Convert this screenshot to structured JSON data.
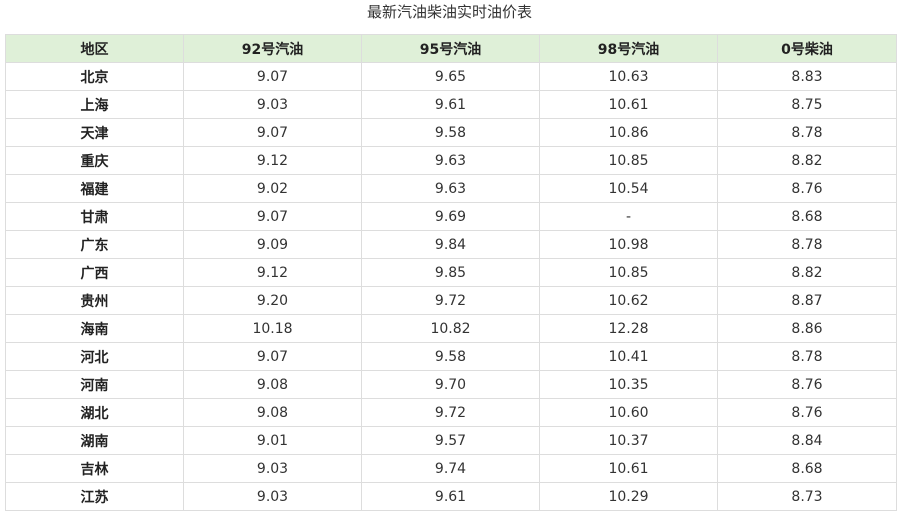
{
  "caption": "最新汽油柴油实时油价表",
  "headers": {
    "region": "地区",
    "gas92": "92号汽油",
    "gas95": "95号汽油",
    "gas98": "98号汽油",
    "diesel0": "0号柴油"
  },
  "rows": [
    {
      "region": "北京",
      "gas92": "9.07",
      "gas95": "9.65",
      "gas98": "10.63",
      "diesel0": "8.83"
    },
    {
      "region": "上海",
      "gas92": "9.03",
      "gas95": "9.61",
      "gas98": "10.61",
      "diesel0": "8.75"
    },
    {
      "region": "天津",
      "gas92": "9.07",
      "gas95": "9.58",
      "gas98": "10.86",
      "diesel0": "8.78"
    },
    {
      "region": "重庆",
      "gas92": "9.12",
      "gas95": "9.63",
      "gas98": "10.85",
      "diesel0": "8.82"
    },
    {
      "region": "福建",
      "gas92": "9.02",
      "gas95": "9.63",
      "gas98": "10.54",
      "diesel0": "8.76"
    },
    {
      "region": "甘肃",
      "gas92": "9.07",
      "gas95": "9.69",
      "gas98": "-",
      "diesel0": "8.68"
    },
    {
      "region": "广东",
      "gas92": "9.09",
      "gas95": "9.84",
      "gas98": "10.98",
      "diesel0": "8.78"
    },
    {
      "region": "广西",
      "gas92": "9.12",
      "gas95": "9.85",
      "gas98": "10.85",
      "diesel0": "8.82"
    },
    {
      "region": "贵州",
      "gas92": "9.20",
      "gas95": "9.72",
      "gas98": "10.62",
      "diesel0": "8.87"
    },
    {
      "region": "海南",
      "gas92": "10.18",
      "gas95": "10.82",
      "gas98": "12.28",
      "diesel0": "8.86"
    },
    {
      "region": "河北",
      "gas92": "9.07",
      "gas95": "9.58",
      "gas98": "10.41",
      "diesel0": "8.78"
    },
    {
      "region": "河南",
      "gas92": "9.08",
      "gas95": "9.70",
      "gas98": "10.35",
      "diesel0": "8.76"
    },
    {
      "region": "湖北",
      "gas92": "9.08",
      "gas95": "9.72",
      "gas98": "10.60",
      "diesel0": "8.76"
    },
    {
      "region": "湖南",
      "gas92": "9.01",
      "gas95": "9.57",
      "gas98": "10.37",
      "diesel0": "8.84"
    },
    {
      "region": "吉林",
      "gas92": "9.03",
      "gas95": "9.74",
      "gas98": "10.61",
      "diesel0": "8.68"
    },
    {
      "region": "江苏",
      "gas92": "9.03",
      "gas95": "9.61",
      "gas98": "10.29",
      "diesel0": "8.73"
    }
  ],
  "colors": {
    "header_bg": "#dff0d8",
    "border": "#dddddd",
    "text": "#333333"
  }
}
